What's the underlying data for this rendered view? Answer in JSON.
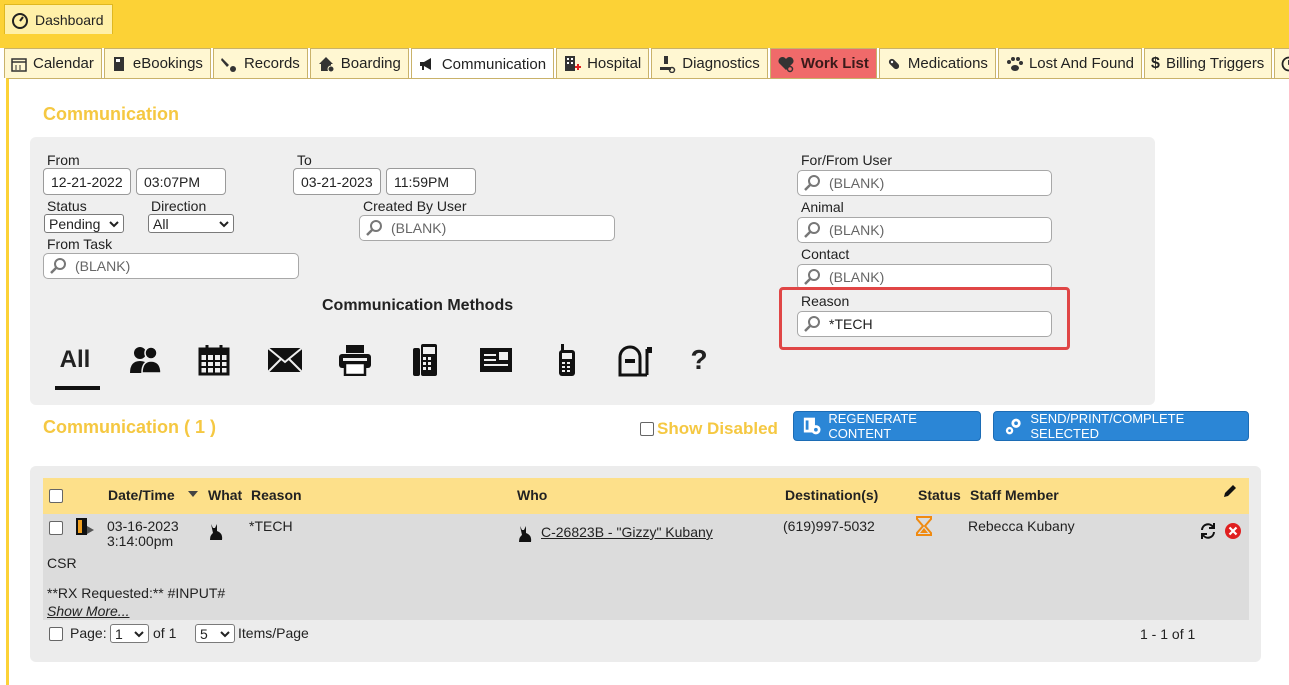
{
  "top": {
    "dashboard_label": "Dashboard"
  },
  "tabs": [
    {
      "label": "Calendar",
      "icon": "calendar-icon"
    },
    {
      "label": "eBookings",
      "icon": "book-icon"
    },
    {
      "label": "Records",
      "icon": "records-icon"
    },
    {
      "label": "Boarding",
      "icon": "house-paw-icon"
    },
    {
      "label": "Communication",
      "icon": "megaphone-icon",
      "active": true
    },
    {
      "label": "Hospital",
      "icon": "hospital-icon"
    },
    {
      "label": "Diagnostics",
      "icon": "microscope-icon"
    },
    {
      "label": "Work List",
      "icon": "heart-icon"
    },
    {
      "label": "Medications",
      "icon": "pill-icon"
    },
    {
      "label": "Lost And Found",
      "icon": "paw-icon"
    },
    {
      "label": "Billing Triggers",
      "icon": "dollar-icon"
    }
  ],
  "page": {
    "title": "Communication"
  },
  "filters": {
    "from_label": "From",
    "from_date": "12-21-2022",
    "from_time": "03:07PM",
    "to_label": "To",
    "to_date": "03-21-2023",
    "to_time": "11:59PM",
    "status_label": "Status",
    "status_value": "Pending",
    "direction_label": "Direction",
    "direction_value": "All",
    "created_by_label": "Created By User",
    "created_by_value": "(BLANK)",
    "from_task_label": "From Task",
    "from_task_value": "(BLANK)",
    "for_from_user_label": "For/From User",
    "for_from_user_value": "(BLANK)",
    "animal_label": "Animal",
    "animal_value": "(BLANK)",
    "contact_label": "Contact",
    "contact_value": "(BLANK)",
    "reason_label": "Reason",
    "reason_value": "*TECH"
  },
  "methods": {
    "title": "Communication Methods",
    "all_label": "All",
    "unknown_label": "?"
  },
  "list": {
    "title": "Communication ( 1 )",
    "show_disabled_label": "Show Disabled",
    "regenerate_label": "REGENERATE CONTENT",
    "send_label": "SEND/PRINT/COMPLETE SELECTED",
    "headers": {
      "datetime": "Date/Time",
      "what": "What",
      "reason": "Reason",
      "who": "Who",
      "destination": "Destination(s)",
      "status": "Status",
      "staff": "Staff Member"
    },
    "row": {
      "date": "03-16-2023",
      "time": "3:14:00pm",
      "reason": "*TECH",
      "who": "C-26823B - \"Gizzy\" Kubany",
      "destination": "(619)997-5032",
      "staff": "Rebecca Kubany",
      "note_line1": "CSR",
      "note_line2": "**RX Requested:** #INPUT#",
      "show_more": "Show More..."
    },
    "pager": {
      "page_label": "Page:",
      "page_value": "1",
      "of_label": "of 1",
      "per_page_value": "5",
      "per_page_label": "Items/Page",
      "range": "1 - 1 of 1"
    }
  },
  "colors": {
    "accent_yellow": "#fcd236",
    "title_yellow": "#f5c842",
    "button_blue": "#2b86d6",
    "highlight_red": "#e04646"
  }
}
